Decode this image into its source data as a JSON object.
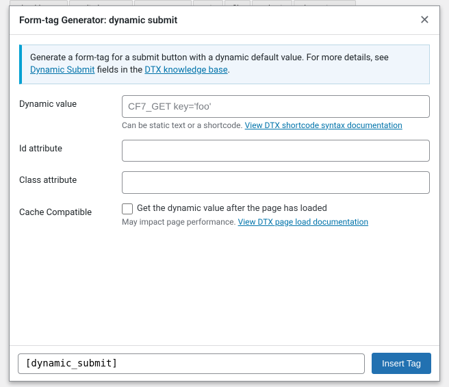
{
  "bg_tabs": [
    "checkboxes",
    "radio buttons",
    "acceptance",
    "quiz",
    "file",
    "submit",
    "dynamic text"
  ],
  "modal": {
    "title": "Form-tag Generator: dynamic submit",
    "info_text_before": "Generate a form-tag for a submit button with a dynamic default value. For more details, see ",
    "info_link1": "Dynamic Submit",
    "info_text_mid": " fields in the ",
    "info_link2": "DTX knowledge base",
    "info_text_end": "."
  },
  "fields": {
    "dynamic_value": {
      "label": "Dynamic value",
      "placeholder": "CF7_GET key='foo'",
      "value": "",
      "help_text": "Can be static text or a shortcode. ",
      "help_link": "View DTX shortcode syntax documentation"
    },
    "id_attr": {
      "label": "Id attribute",
      "value": ""
    },
    "class_attr": {
      "label": "Class attribute",
      "value": ""
    },
    "cache": {
      "label": "Cache Compatible",
      "checkbox_label": "Get the dynamic value after the page has loaded",
      "help_text": "May impact page performance. ",
      "help_link": "View DTX page load documentation"
    }
  },
  "footer": {
    "tag_output": "[dynamic_submit]",
    "insert_label": "Insert Tag"
  }
}
